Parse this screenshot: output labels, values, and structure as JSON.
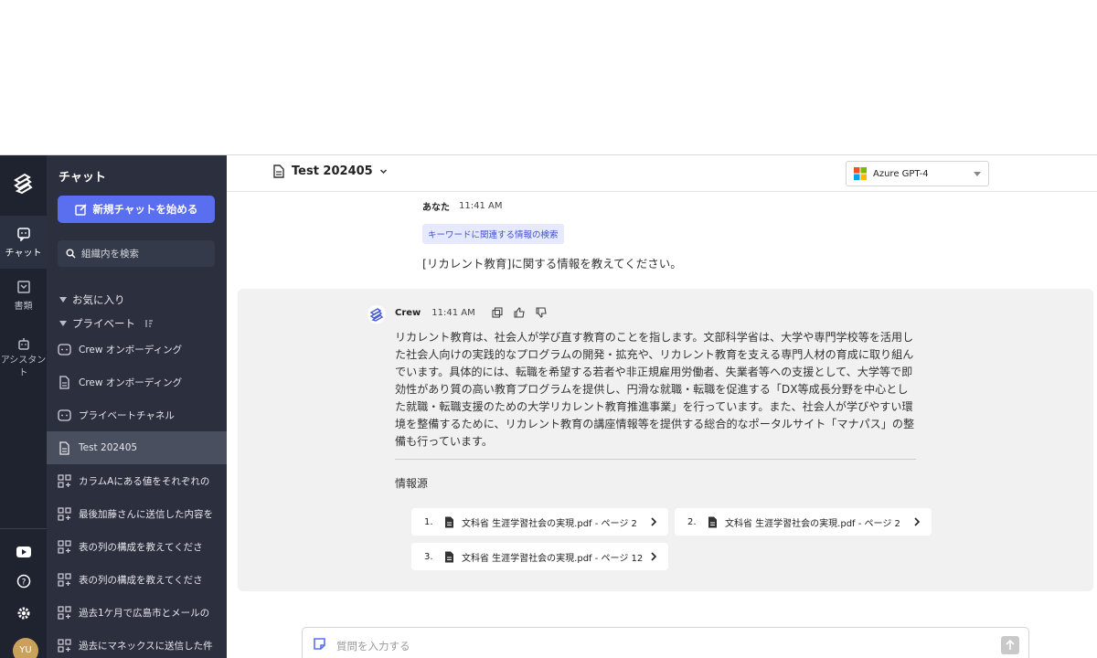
{
  "rail": {
    "items": [
      {
        "label": "チャット",
        "icon": "chat-icon"
      },
      {
        "label": "書類",
        "icon": "document-icon"
      },
      {
        "label": "アシスタント",
        "icon": "robot-icon"
      }
    ],
    "bottom_icons": [
      "youtube-icon",
      "help-icon",
      "gear-icon"
    ],
    "avatar": "YU"
  },
  "sidebar": {
    "title": "チャット",
    "new_chat_label": "新規チャットを始める",
    "search_placeholder": "組織内を検索",
    "favorites_label": "お気に入り",
    "private_label": "プライベート",
    "items": [
      {
        "label": "Crew オンボーディング",
        "icon": "chat-bubble-icon"
      },
      {
        "label": "Crew オンボーディング",
        "icon": "file-icon"
      },
      {
        "label": "プライベートチャネル",
        "icon": "chat-bubble-icon"
      },
      {
        "label": "Test 202405",
        "icon": "file-icon"
      },
      {
        "label": "カラムAにある値をそれぞれの",
        "icon": "grid-plus-icon"
      },
      {
        "label": "最後加藤さんに送信した内容を",
        "icon": "grid-plus-icon"
      },
      {
        "label": "表の列の構成を教えてくださ",
        "icon": "grid-plus-icon"
      },
      {
        "label": "表の列の構成を教えてくださ",
        "icon": "grid-plus-icon"
      },
      {
        "label": "過去1ケ月で広島市とメールの",
        "icon": "grid-plus-icon"
      },
      {
        "label": "過去にマネックスに送信した件",
        "icon": "grid-plus-icon"
      }
    ]
  },
  "header": {
    "doc_title": "Test 202405",
    "model": "Azure GPT-4"
  },
  "conversation": {
    "user": {
      "author": "あなた",
      "time": "11:41 AM",
      "tag": "キーワードに関連する情報の検索",
      "text": "[リカレント教育]に関する情報を教えてください。"
    },
    "bot": {
      "author": "Crew",
      "time": "11:41 AM",
      "text": "リカレント教育は、社会人が学び直す教育のことを指します。文部科学省は、大学や専門学校等を活用した社会人向けの実践的なプログラムの開発・拡充や、リカレント教育を支える専門人材の育成に取り組んでいます。具体的には、転職を希望する若者や非正規雇用労働者、失業者等への支援として、大学等で即効性があり質の高い教育プログラムを提供し、円滑な就職・転職を促進する「DX等成長分野を中心とした就職・転職支援のための大学リカレント教育推進事業」を行っています。また、社会人が学びやすい環境を整備するために、リカレント教育の講座情報等を提供する総合的なポータルサイト「マナパス」の整備も行っています。",
      "sources_title": "情報源",
      "sources": [
        {
          "num": "1.",
          "label": "文科省 生涯学習社会の実現.pdf - ページ 2"
        },
        {
          "num": "2.",
          "label": "文科省 生涯学習社会の実現.pdf - ページ 2"
        },
        {
          "num": "3.",
          "label": "文科省 生涯学習社会の実現.pdf - ページ 12"
        }
      ]
    }
  },
  "input": {
    "placeholder": "質問を入力する"
  },
  "colors": {
    "accent": "#5a6ef0",
    "sidebar_bg": "#2b2f3e",
    "rail_bg": "#1f2330"
  }
}
